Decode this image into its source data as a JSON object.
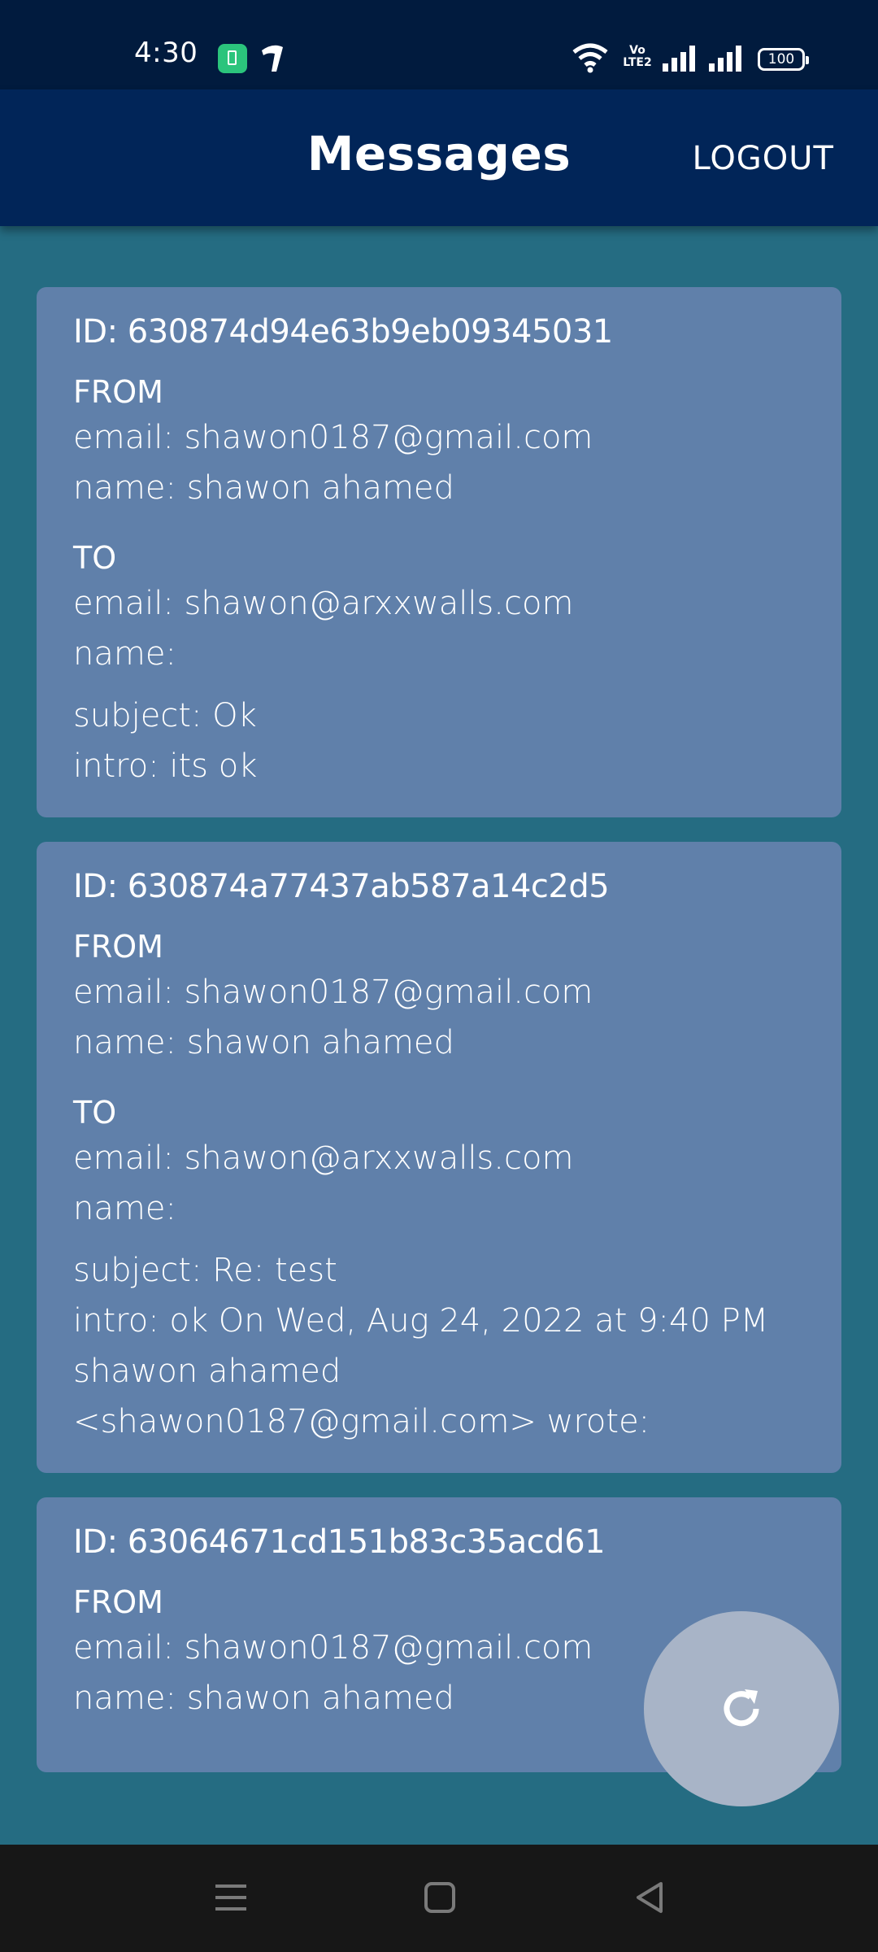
{
  "status_bar": {
    "time": "4:30",
    "battery": "100",
    "network_label": "Vo LTE2"
  },
  "app_bar": {
    "title": "Messages",
    "logout_label": "LOGOUT"
  },
  "messages": [
    {
      "id": "ID: 630874d94e63b9eb09345031",
      "from_heading": "FROM",
      "from_email": "email: shawon0187@gmail.com",
      "from_name": "name: shawon ahamed",
      "to_heading": "TO",
      "to_email": "email: shawon@arxxwalls.com",
      "to_name": "name:",
      "subject": "subject: Ok",
      "intro": "intro: its ok"
    },
    {
      "id": "ID: 630874a77437ab587a14c2d5",
      "from_heading": "FROM",
      "from_email": "email: shawon0187@gmail.com",
      "from_name": "name: shawon ahamed",
      "to_heading": "TO",
      "to_email": "email: shawon@arxxwalls.com",
      "to_name": "name:",
      "subject": "subject: Re: test",
      "intro_lines": [
        "intro: ok On Wed, Aug 24, 2022 at 9:40 PM",
        "shawon ahamed",
        "<shawon0187@gmail.com> wrote:"
      ]
    },
    {
      "id": "ID: 63064671cd151b83c35acd61",
      "from_heading": "FROM",
      "from_email": "email: shawon0187@gmail.com",
      "from_name": "name: shawon ahamed"
    }
  ],
  "fab": {
    "icon": "refresh-icon"
  },
  "colors": {
    "background": "#256c82",
    "status_bar": "#011b3e",
    "app_bar": "#012558",
    "card": "#6080aa",
    "fab": "#a8b4c7",
    "nav_bar": "#171717"
  }
}
